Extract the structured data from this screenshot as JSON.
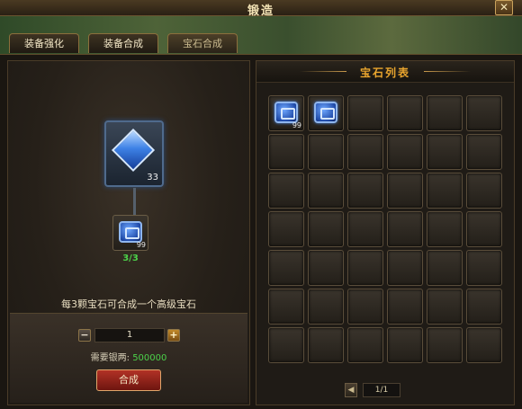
{
  "window": {
    "title": "锻造",
    "close_label": "✕"
  },
  "tabs": [
    {
      "label": "装备强化",
      "active": false
    },
    {
      "label": "装备合成",
      "active": false
    },
    {
      "label": "宝石合成",
      "active": true
    }
  ],
  "synthesis": {
    "target_gem": {
      "icon": "blue-diamond-gem-icon",
      "count": "33"
    },
    "material_gem": {
      "icon": "blue-square-gem-icon",
      "count": "99"
    },
    "progress": "3/3",
    "hint": "每3颗宝石可合成一个高级宝石",
    "quantity": "1",
    "cost_label": "需要银两:",
    "cost_value": "500000",
    "craft_button": "合成"
  },
  "gem_list": {
    "title": "宝石列表",
    "items": [
      {
        "icon": "blue-square-gem-icon",
        "count": "99"
      },
      {
        "icon": "blue-square-gem-icon",
        "count": ""
      }
    ],
    "total_slots": 42,
    "page": "1/1"
  },
  "colors": {
    "accent_gold": "#e9a52e",
    "green_text": "#4cd24a",
    "craft_button_red": "#b23226"
  }
}
